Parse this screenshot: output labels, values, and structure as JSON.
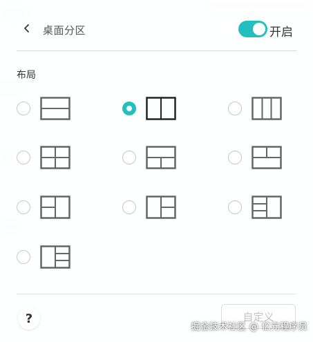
{
  "header": {
    "title": "桌面分区",
    "back_icon": "chevron-left-icon",
    "toggle_on": true,
    "toggle_label": "开启"
  },
  "section": {
    "label": "布局"
  },
  "layouts": [
    {
      "id": "h-split",
      "selected": false
    },
    {
      "id": "v-split",
      "selected": true
    },
    {
      "id": "three-col",
      "selected": false
    },
    {
      "id": "quad",
      "selected": false
    },
    {
      "id": "two-top-one-bottom",
      "selected": false
    },
    {
      "id": "one-top-two-bottom",
      "selected": false
    },
    {
      "id": "left-big-right-two-rows",
      "selected": false
    },
    {
      "id": "two-left-right-big",
      "selected": false
    },
    {
      "id": "left-big-right-three-rows",
      "selected": false
    },
    {
      "id": "left-big-right-three-rows-alt",
      "selected": false
    }
  ],
  "footer": {
    "help_label": "?",
    "custom_button": "自定义"
  },
  "watermark": "掘金技术社区 @ 亿元程序员",
  "colors": {
    "accent": "#23bfbf",
    "thumb_stroke": "#666666",
    "thumb_stroke_selected": "#222222"
  }
}
